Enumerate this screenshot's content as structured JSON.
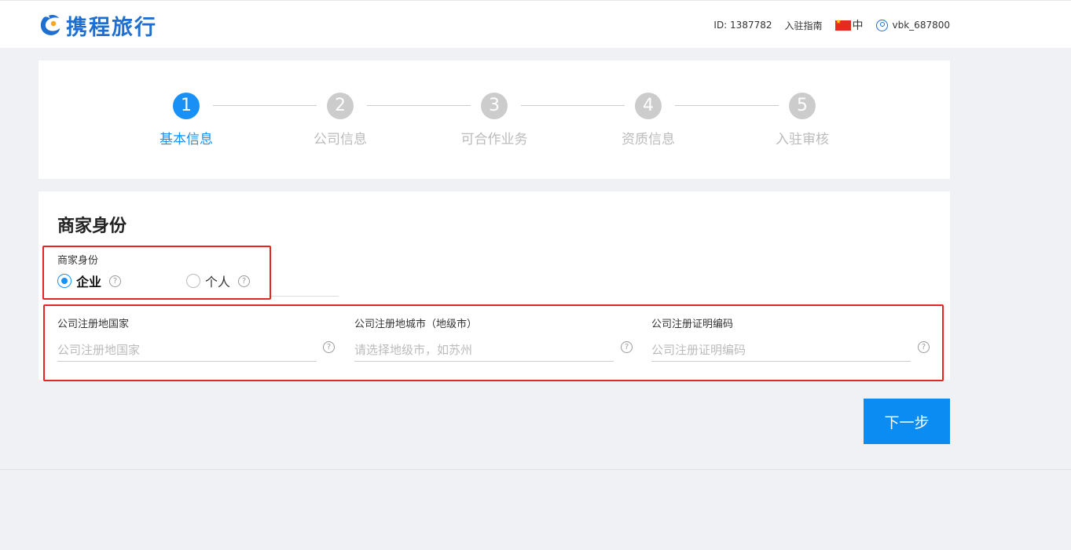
{
  "header": {
    "logo_text": "携程旅行",
    "id_text": "ID: 1387782",
    "guide_link": "入驻指南",
    "language": "中",
    "username": "vbk_687800"
  },
  "steps": [
    {
      "number": "1",
      "label": "基本信息",
      "active": true
    },
    {
      "number": "2",
      "label": "公司信息",
      "active": false
    },
    {
      "number": "3",
      "label": "可合作业务",
      "active": false
    },
    {
      "number": "4",
      "label": "资质信息",
      "active": false
    },
    {
      "number": "5",
      "label": "入驻审核",
      "active": false
    }
  ],
  "form": {
    "section_title": "商家身份",
    "identity": {
      "label": "商家身份",
      "options": [
        {
          "label": "企业",
          "selected": true
        },
        {
          "label": "个人",
          "selected": false
        }
      ]
    },
    "fields": [
      {
        "label": "公司注册地国家",
        "placeholder": "公司注册地国家",
        "value": ""
      },
      {
        "label": "公司注册地城市（地级市）",
        "placeholder": "请选择地级市，如苏州",
        "value": ""
      },
      {
        "label": "公司注册证明编码",
        "placeholder": "公司注册证明编码",
        "value": ""
      }
    ],
    "help_glyph": "?"
  },
  "next_button": "下一步",
  "colors": {
    "primary": "#1890f5",
    "button": "#0b8cf2",
    "highlight_border": "#e5251e",
    "logo": "#1f6fd1"
  }
}
